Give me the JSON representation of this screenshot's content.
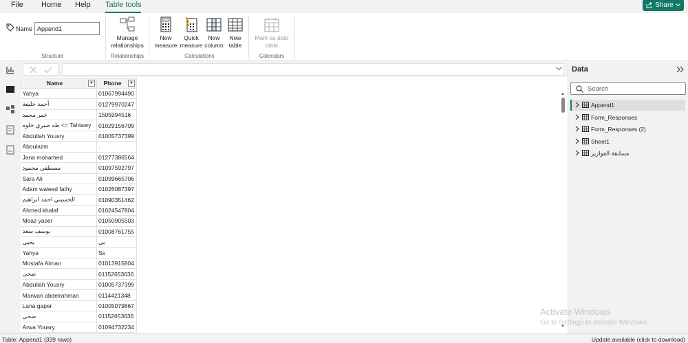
{
  "menu": {
    "file": "File",
    "home": "Home",
    "help": "Help",
    "table_tools": "Table tools",
    "share": "Share"
  },
  "ribbon": {
    "name_label": "Name",
    "name_value": "Append1",
    "groups": {
      "structure": "Structure",
      "relationships": "Relationships",
      "calculations": "Calculations",
      "calendars": "Calendars"
    },
    "buttons": {
      "manage_relationships_l1": "Manage",
      "manage_relationships_l2": "relationships",
      "new_measure_l1": "New",
      "new_measure_l2": "measure",
      "quick_measure_l1": "Quick",
      "quick_measure_l2": "measure",
      "new_column_l1": "New",
      "new_column_l2": "column",
      "new_table_l1": "New",
      "new_table_l2": "table",
      "mark_date_l1": "Mark as date",
      "mark_date_l2": "table"
    }
  },
  "table": {
    "headers": [
      "Name",
      "Phone"
    ],
    "rows": [
      [
        "Yahya",
        "01067994490"
      ],
      [
        "أحمد خليفة",
        "01279970247"
      ],
      [
        "عمر محمد",
        "1505994516"
      ],
      [
        "طه صبري خلوه <= Tahtawy",
        "01029156709"
      ],
      [
        "Abdullah Yousry",
        "01005737399"
      ],
      [
        "Aboulazm",
        "."
      ],
      [
        "Jana mohamed",
        "01277386564"
      ],
      [
        "مصطفي محمود",
        "01097592797"
      ],
      [
        "Sara Ali",
        "01099665706"
      ],
      [
        "Adam waleed fathy",
        "01026087397"
      ],
      [
        "الحسيني احمد ابراهيم",
        "01090351462"
      ],
      [
        "Ahmed khalaf",
        "01024547804"
      ],
      [
        "Moaz yaser",
        "01050905503"
      ],
      [
        "يوسف سعد",
        "01008761755"
      ],
      [
        "يحيى",
        "يي"
      ],
      [
        "Yahya",
        "Ss"
      ],
      [
        "Mostafa Aiman",
        "01013915804"
      ],
      [
        "ضحى",
        "01152653636"
      ],
      [
        "Abdullah Yousry",
        "01005737399"
      ],
      [
        "Marwan abdelrahman",
        "0114421348"
      ],
      [
        "Lana gaper",
        "01005079867"
      ],
      [
        "ضحى",
        "01152653636"
      ],
      [
        "Arwa Yousry",
        "01094732234"
      ]
    ]
  },
  "data_pane": {
    "title": "Data",
    "search_placeholder": "Search",
    "items": [
      "Append1",
      "Form_Responses",
      "Form_Responses (2)",
      "Sheet1",
      "مسابقة الفوازير"
    ]
  },
  "watermark": {
    "line1": "Activate Windows",
    "line2": "Go to Settings to activate Windows."
  },
  "status": {
    "left": "Table: Append1 (339 rows)",
    "right": "Update available (click to download)"
  },
  "colors": {
    "accent": "#117865"
  }
}
